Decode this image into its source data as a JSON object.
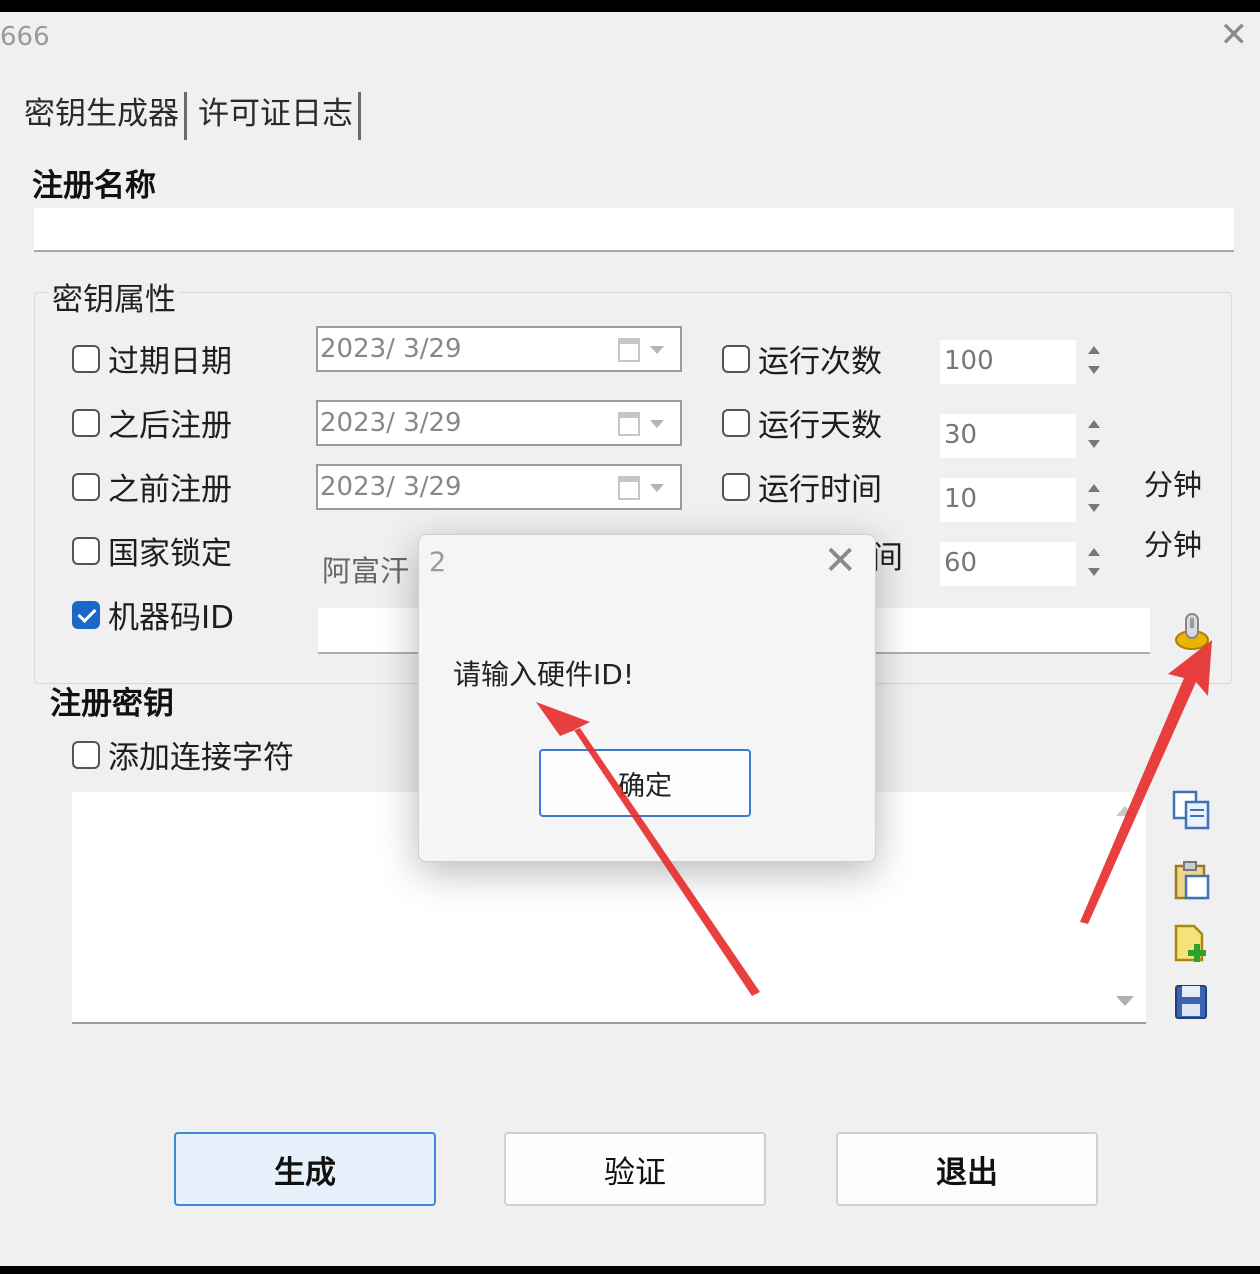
{
  "window": {
    "title": "666"
  },
  "tabs": [
    "密钥生成器",
    "许可证日志"
  ],
  "reg_name": {
    "label": "注册名称",
    "value": ""
  },
  "key_props": {
    "title": "密钥属性",
    "expiry": {
      "label": "过期日期",
      "checked": false,
      "date": "2023/  3/29"
    },
    "after": {
      "label": "之后注册",
      "checked": false,
      "date": "2023/  3/29"
    },
    "before": {
      "label": "之前注册",
      "checked": false,
      "date": "2023/  3/29"
    },
    "country": {
      "label": "国家锁定",
      "checked": false,
      "value": "阿富汗"
    },
    "hwid": {
      "label": "机器码ID",
      "checked": true,
      "value": ""
    },
    "run_count": {
      "label": "运行次数",
      "checked": false,
      "value": "100"
    },
    "run_days": {
      "label": "运行天数",
      "checked": false,
      "value": "30"
    },
    "run_time": {
      "label": "运行时间",
      "checked": false,
      "value": "10",
      "unit": "分钟"
    },
    "hidden_row": {
      "label_tail": "间",
      "value": "60",
      "unit": "分钟"
    }
  },
  "reg_key": {
    "label": "注册密钥",
    "add_sep_label": "添加连接字符",
    "add_sep_checked": false,
    "value": ""
  },
  "buttons": {
    "generate": "生成",
    "verify": "验证",
    "exit": "退出"
  },
  "dialog": {
    "title": "2",
    "message": "请输入硬件ID!",
    "ok": "确定"
  },
  "icons": [
    "close-icon",
    "calendar-icon",
    "spin-up-icon",
    "spin-down-icon",
    "hardware-id-icon",
    "copy-icon",
    "paste-icon",
    "add-document-icon",
    "save-icon"
  ],
  "colors": {
    "accent": "#1a67c9",
    "annotation_arrow": "#e52a2a"
  }
}
